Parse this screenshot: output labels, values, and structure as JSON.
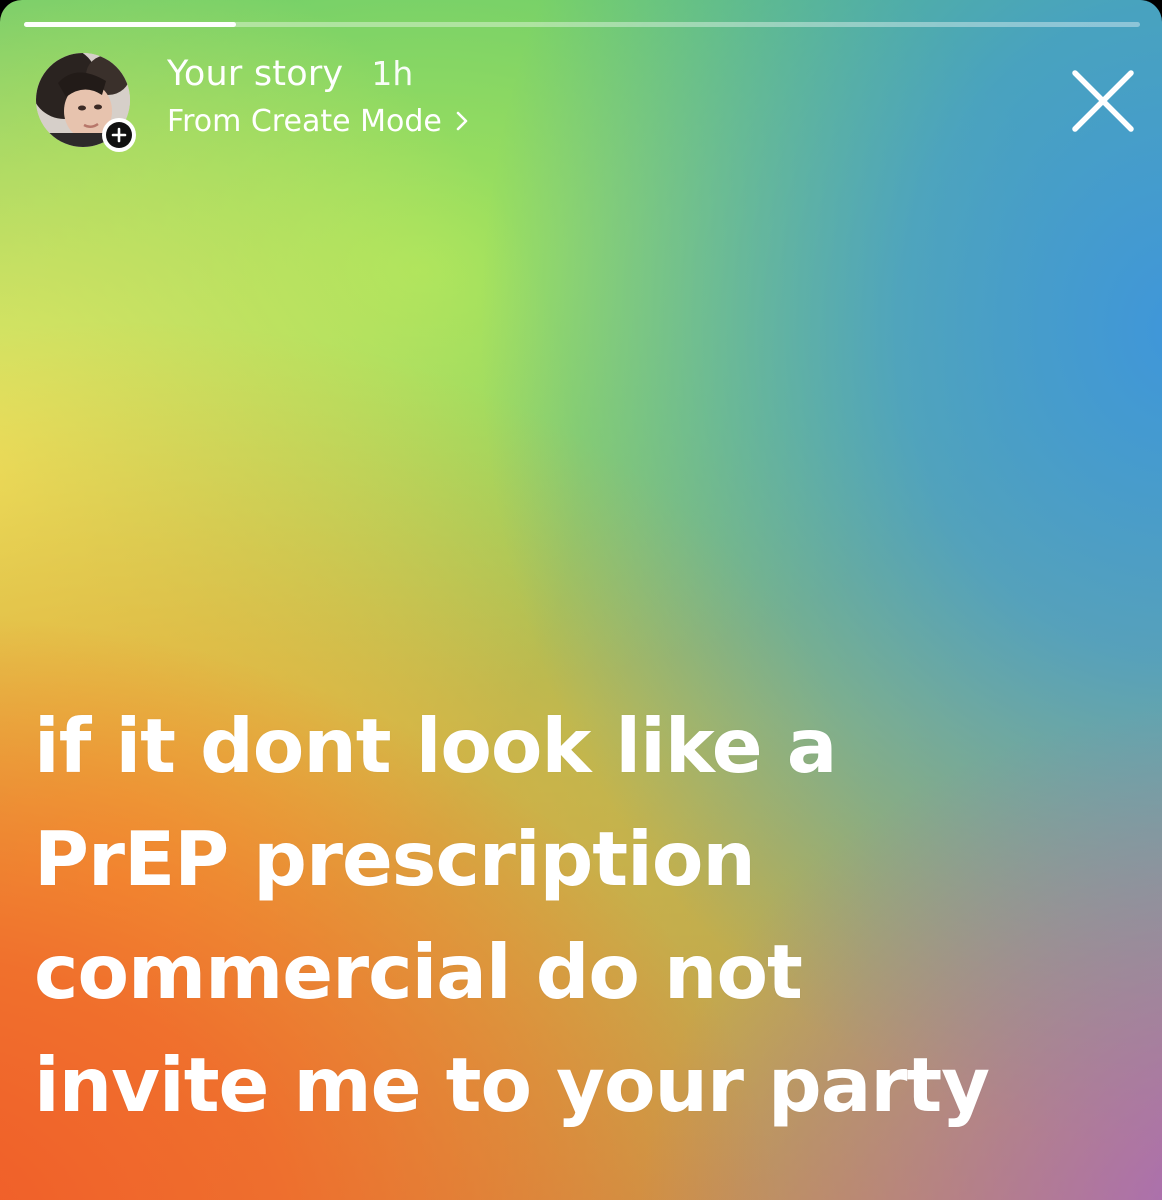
{
  "story": {
    "progress": 0.19,
    "header": {
      "username": "Your story",
      "timestamp": "1h",
      "source_label": "From Create Mode",
      "source_chevron": "›"
    },
    "icons": {
      "avatar": "profile-photo",
      "add": "plus-circle-icon",
      "close": "close-icon",
      "chevron": "chevron-right-icon"
    },
    "text_lines": [
      "if it dont look like a",
      "PrEP prescription",
      "commercial do not",
      "invite me to your party"
    ],
    "colors": {
      "text": "#ffffff",
      "gradient_top": "#63c86e",
      "gradient_left": "#ece862",
      "gradient_right": "#3f96da",
      "gradient_bottom_left": "#f25a28",
      "gradient_bottom_right": "#a666c4"
    }
  }
}
